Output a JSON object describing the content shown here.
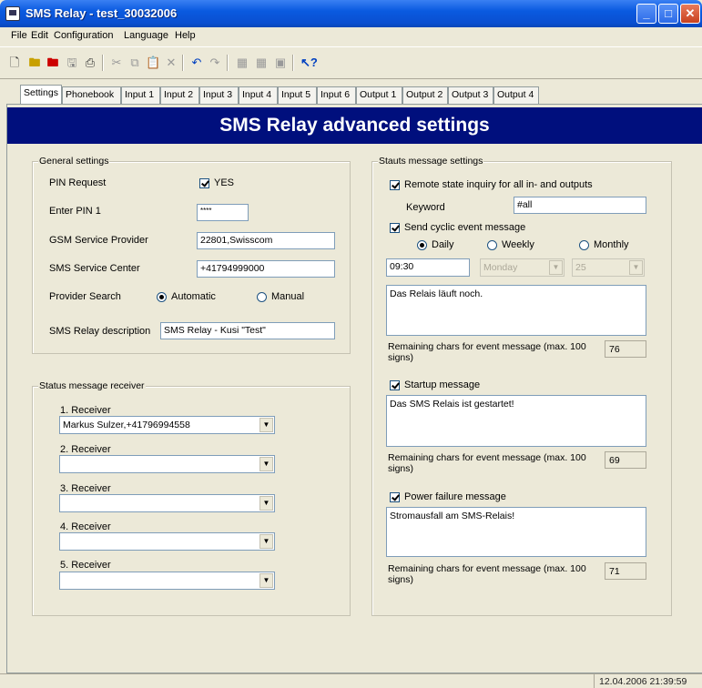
{
  "window": {
    "title": "SMS Relay - test_30032006",
    "buttons": [
      "_",
      "□",
      "✕"
    ]
  },
  "menu": [
    "File",
    "Edit",
    "Configuration",
    "Language",
    "Help"
  ],
  "toolbar_icons": [
    "new-icon",
    "open-icon",
    "open-red-icon",
    "save-icon",
    "print-icon",
    "cut-icon",
    "copy-icon",
    "paste-icon",
    "delete-icon",
    "undo-icon",
    "redo-icon",
    "read-device-icon",
    "write-device-icon",
    "device-icon",
    "help-icon"
  ],
  "tabs": [
    "Settings",
    "Phonebook",
    "Input 1",
    "Input 2",
    "Input 3",
    "Input 4",
    "Input 5",
    "Input 6",
    "Output 1",
    "Output 2",
    "Output 3",
    "Output 4"
  ],
  "banner": "SMS Relay advanced settings",
  "general": {
    "title": "General settings",
    "pin_request_label": "PIN Request",
    "pin_request_value": "YES",
    "enter_pin_label": "Enter PIN 1",
    "pin_value": "****",
    "provider_label": "GSM Service Provider",
    "provider_value": "22801,Swisscom",
    "center_label": "SMS Service Center",
    "center_value": "+41794999000",
    "search_label": "Provider Search",
    "search_auto": "Automatic",
    "search_manual": "Manual",
    "description_label": "SMS Relay description",
    "description_value": "SMS Relay - Kusi \"Test\""
  },
  "receivers": {
    "title": "Status message receiver",
    "items": [
      {
        "label": "1. Receiver",
        "value": "Markus Sulzer,+41796994558"
      },
      {
        "label": "2. Receiver",
        "value": ""
      },
      {
        "label": "3. Receiver",
        "value": ""
      },
      {
        "label": "4. Receiver",
        "value": ""
      },
      {
        "label": "5. Receiver",
        "value": ""
      }
    ]
  },
  "status_msg": {
    "title": "Stauts message settings",
    "remote_inquiry": "Remote state inquiry for all in- and outputs",
    "keyword_label": "Keyword",
    "keyword_value": "#all",
    "cyclic": "Send cyclic event message",
    "daily": "Daily",
    "weekly": "Weekly",
    "monthly": "Monthly",
    "time_value": "09:30",
    "weekday_value": "Monday",
    "monthday_value": "25",
    "event_text": "Das Relais läuft noch.",
    "remaining_label": "Remaining chars for event message (max. 100 signs)",
    "remaining_event": "76",
    "startup": "Startup message",
    "startup_text": "Das SMS Relais ist gestartet!",
    "remaining_startup": "69",
    "power": "Power failure message",
    "power_text": "Stromausfall am SMS-Relais!",
    "remaining_power": "71"
  },
  "statusbar": "12.04.2006 21:39:59"
}
